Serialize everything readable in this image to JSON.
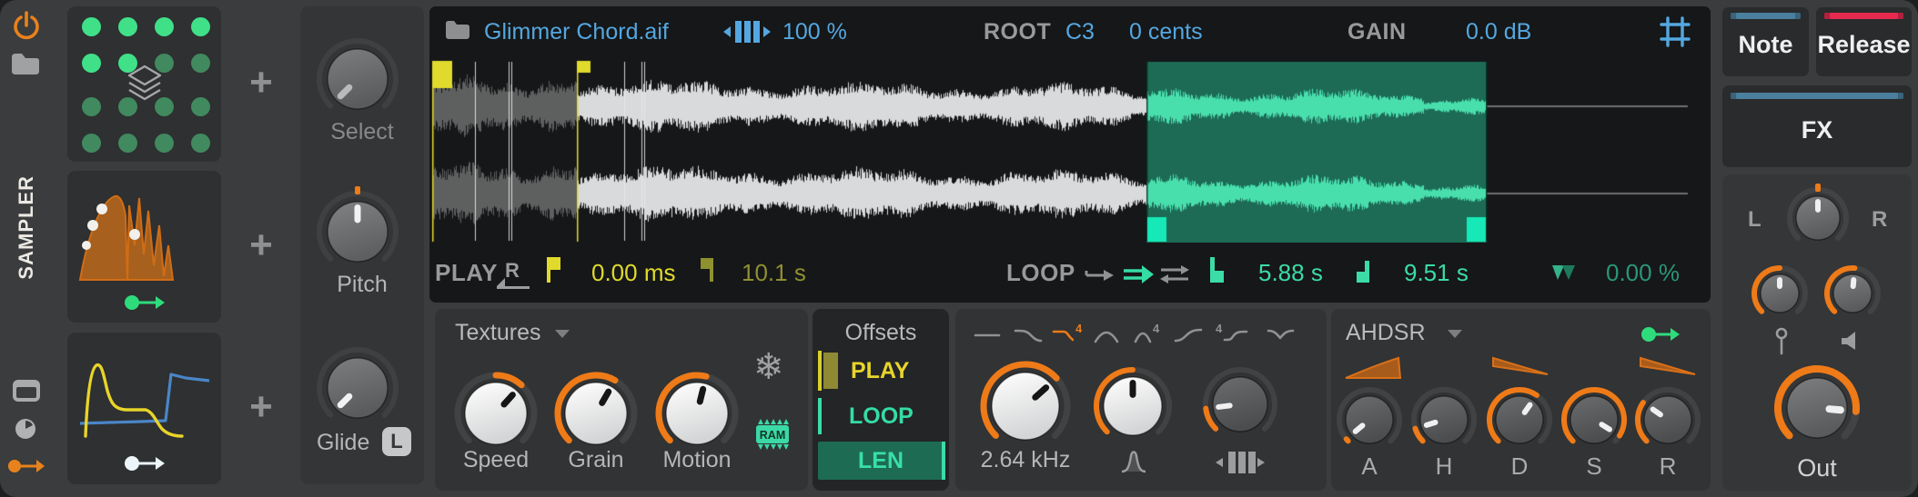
{
  "app": {
    "device_name": "SAMPLER"
  },
  "icons": {
    "freeze": "❄",
    "add": "+",
    "reverse": "R"
  },
  "header": {
    "file_name": "Glimmer Chord.aif",
    "stretch_value": "100 %",
    "root_label": "ROOT",
    "root_note": "C3",
    "root_detune": "0 cents",
    "gain_label": "GAIN",
    "gain_value": "0.0 dB"
  },
  "markers": {
    "play_label": "PLAY",
    "play_start": "0.00 ms",
    "play_end": "10.1 s",
    "loop_label": "LOOP",
    "loop_start": "5.88 s",
    "loop_end": "9.51 s",
    "loop_crossfade": "0.00 %"
  },
  "textures": {
    "title": "Textures",
    "speed_label": "Speed",
    "grain_label": "Grain",
    "motion_label": "Motion",
    "ram_label": "RAM"
  },
  "offsets": {
    "title": "Offsets",
    "play": "PLAY",
    "loop": "LOOP",
    "len": "LEN"
  },
  "filter": {
    "cutoff_value": "2.64 kHz",
    "selected_type": "LP4"
  },
  "envelope": {
    "title": "AHDSR",
    "attack": "A",
    "hold": "H",
    "decay": "D",
    "sustain": "S",
    "release": "R"
  },
  "voice": {
    "select_label": "Select",
    "pitch_label": "Pitch",
    "glide_label": "Glide",
    "glide_mode_badge": "L"
  },
  "tabs": {
    "note": "Note",
    "release": "Release",
    "fx": "FX"
  },
  "output": {
    "pan_left": "L",
    "pan_right": "R",
    "out_label": "Out"
  },
  "layer_grid": {
    "pattern": [
      "1111",
      "1100",
      "0000",
      "0000"
    ]
  },
  "colors": {
    "accent_orange": "#ee7a18",
    "text_blue": "#54a7e0",
    "marker_yellow": "#e0da2c",
    "marker_olive": "#8f9030",
    "loop_teal": "#3bdca6",
    "loop_dim_teal": "#2a9678",
    "loop_bg": "#1d6b55",
    "handle_cyan": "#16e9b7",
    "tab_blue": "#4b7f9e",
    "tab_red": "#e62a4e",
    "mod_green": "#2edc7c"
  }
}
